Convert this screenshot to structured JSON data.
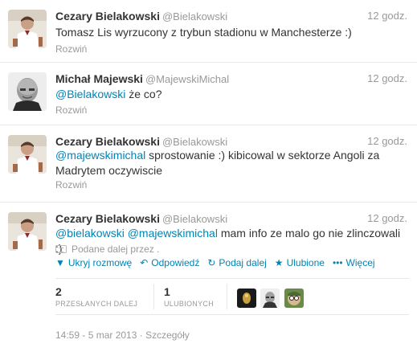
{
  "tweets": [
    {
      "fullname": "Cezary Bielakowski",
      "username": "@Bielakowski",
      "time": "12 godz.",
      "text_plain": "Tomasz Lis wyrzucony z trybun stadionu w Manchesterze :)",
      "expand": "Rozwiń"
    },
    {
      "fullname": "Michał Majewski",
      "username": "@MajewskiMichal",
      "time": "12 godz.",
      "mention": "@Bielakowski",
      "text_rest": " że co?",
      "expand": "Rozwiń"
    },
    {
      "fullname": "Cezary Bielakowski",
      "username": "@Bielakowski",
      "time": "12 godz.",
      "mention": "@majewskimichal",
      "text_rest": " sprostowanie :) kibicowal w sektorze Angoli za Madrytem oczywiscie",
      "expand": "Rozwiń"
    },
    {
      "fullname": "Cezary Bielakowski",
      "username": "@Bielakowski",
      "time": "12 godz.",
      "mention1": "@bielakowski",
      "mention2": "@majewskimichal",
      "text_rest": " mam info ze malo go nie zlinczowali :)",
      "retweeted_by": "Podane dalej przez ."
    }
  ],
  "actions": [
    {
      "label": "Ukryj rozmowę",
      "icon": "collapse-icon"
    },
    {
      "label": "Odpowiedź",
      "icon": "reply-icon"
    },
    {
      "label": "Podaj dalej",
      "icon": "retweet-icon"
    },
    {
      "label": "Ulubione",
      "icon": "star-icon"
    },
    {
      "label": "Więcej",
      "icon": "more-icon"
    }
  ],
  "stats": {
    "retweets_count": "2",
    "retweets_label": "PRZESŁANYCH DALEJ",
    "favorites_count": "1",
    "favorites_label": "ULUBIONYCH"
  },
  "footer": {
    "timestamp": "14:59 - 5 mar 2013",
    "separator": " · ",
    "details": "Szczegóły"
  },
  "colors": {
    "link": "#0084b4",
    "muted": "#999999",
    "text": "#333333",
    "divider": "#e8e8e8"
  }
}
